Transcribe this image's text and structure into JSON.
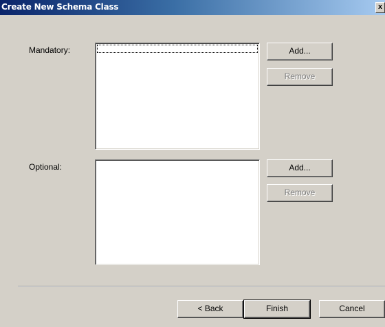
{
  "window": {
    "title": "Create New Schema Class",
    "close_glyph": "x"
  },
  "mandatory": {
    "label": "Mandatory:",
    "add_label": "Add...",
    "remove_label": "Remove",
    "items": []
  },
  "optional": {
    "label": "Optional:",
    "add_label": "Add...",
    "remove_label": "Remove",
    "items": []
  },
  "footer": {
    "back_label": "< Back",
    "finish_label": "Finish",
    "cancel_label": "Cancel"
  }
}
